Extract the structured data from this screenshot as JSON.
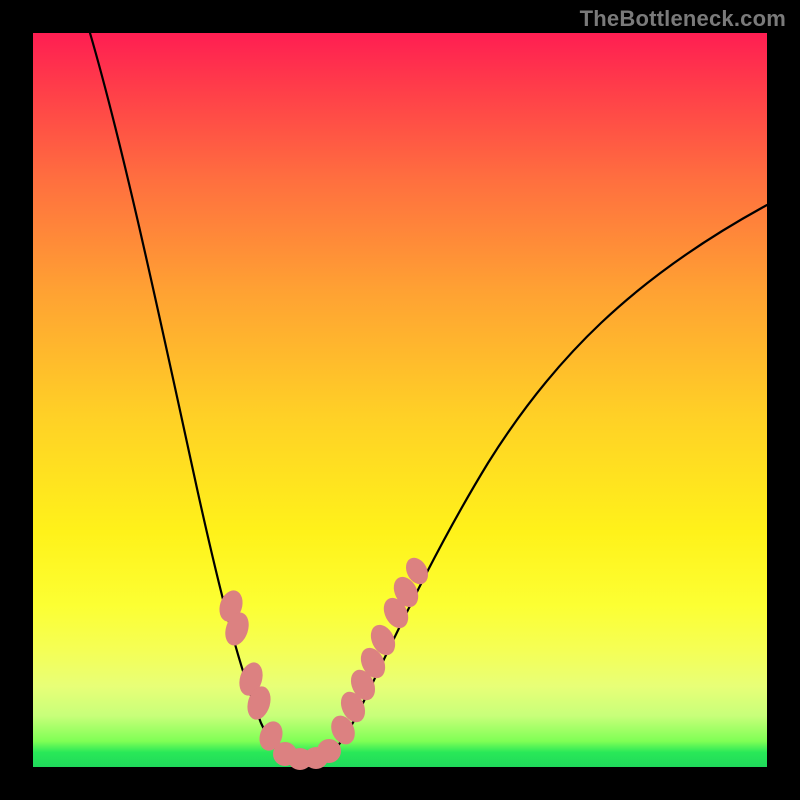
{
  "attribution": "TheBottleneck.com",
  "colors": {
    "frame": "#000000",
    "marker": "#dc8181",
    "curve": "#000000",
    "gradient_top": "#ff1e52",
    "gradient_bottom": "#1fd95a"
  },
  "chart_data": {
    "type": "line",
    "title": "",
    "xlabel": "",
    "ylabel": "",
    "xlim": [
      0,
      100
    ],
    "ylim": [
      0,
      100
    ],
    "background": "vertical-gradient red→yellow→green",
    "series": [
      {
        "name": "bottleneck-curve",
        "x": [
          8,
          12,
          16,
          20,
          24,
          28,
          32,
          34,
          36,
          38,
          40,
          44,
          50,
          58,
          68,
          80,
          92,
          100
        ],
        "y": [
          100,
          84,
          68,
          52,
          38,
          24,
          10,
          4,
          1,
          0,
          1,
          6,
          16,
          30,
          46,
          60,
          72,
          77
        ]
      }
    ],
    "markers": [
      {
        "x": 27,
        "y": 22
      },
      {
        "x": 28,
        "y": 19
      },
      {
        "x": 30,
        "y": 12
      },
      {
        "x": 31,
        "y": 9
      },
      {
        "x": 32,
        "y": 4
      },
      {
        "x": 34,
        "y": 2
      },
      {
        "x": 36,
        "y": 1
      },
      {
        "x": 38,
        "y": 1
      },
      {
        "x": 40,
        "y": 2
      },
      {
        "x": 42,
        "y": 5
      },
      {
        "x": 44,
        "y": 8
      },
      {
        "x": 45,
        "y": 11
      },
      {
        "x": 46,
        "y": 14
      },
      {
        "x": 48,
        "y": 17
      },
      {
        "x": 49,
        "y": 21
      },
      {
        "x": 51,
        "y": 24
      },
      {
        "x": 52,
        "y": 27
      }
    ],
    "marker_color": "#dc8181",
    "notes": "V-shaped curve over a red-to-green vertical gradient; no axis ticks or labels visible; minimum of the curve lands on the green band at the bottom; values estimated from pixel positions on a 0–100 normalized scale."
  }
}
